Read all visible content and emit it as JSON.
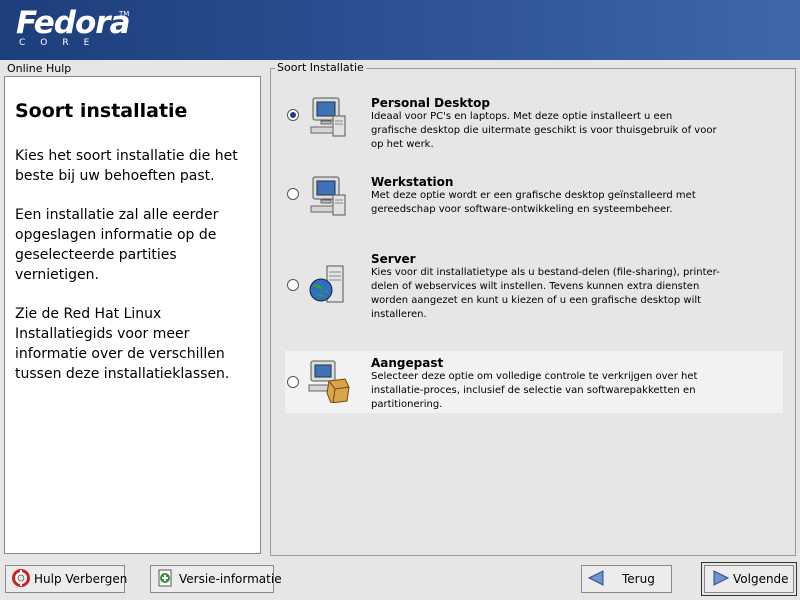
{
  "header": {
    "logo_word": "Fedora",
    "logo_tm": "TM",
    "logo_sub": "CORE"
  },
  "help": {
    "caption": "Online Hulp",
    "title": "Soort installatie",
    "paragraphs": [
      "Kies het soort installatie die het\nbeste bij uw behoeften past.",
      "Een installatie zal alle eerder\nopgeslagen informatie op de\ngeselecteerde partities\nvernietigen.",
      "Zie de Red Hat Linux\nInstallatiegids voor meer\ninformatie over de verschillen\ntussen deze installatieklassen."
    ]
  },
  "options_caption": "Soort Installatie",
  "options": [
    {
      "title": "Personal Desktop",
      "desc": "Ideaal voor PC's en laptops. Met deze optie installeert u een grafische desktop die uitermate geschikt is voor thuisgebruik of voor op het werk.",
      "selected": true,
      "icon": "desktop-computer-icon"
    },
    {
      "title": "Werkstation",
      "desc": "Met deze optie wordt er een grafische desktop geïnstalleerd met gereedschap voor software-ontwikkeling en systeembeheer.",
      "selected": false,
      "icon": "workstation-computer-icon"
    },
    {
      "title": "Server",
      "desc": "Kies voor dit installatietype als u bestand-delen (file-sharing), printer-delen of webservices wilt instellen. Tevens kunnen extra diensten worden aangezet en kunt u kiezen of u een grafische desktop wilt installeren.",
      "selected": false,
      "icon": "server-globe-icon"
    },
    {
      "title": "Aangepast",
      "desc": "Selecteer deze optie om volledige controle te verkrijgen over het installatie-proces, inclusief de selectie van softwarepakketten en partitionering.",
      "selected": false,
      "icon": "custom-package-icon"
    }
  ],
  "buttons": {
    "hide_help": "Hulp Verbergen",
    "release_notes": "Versie-informatie",
    "back": "Terug",
    "next": "Volgende"
  }
}
